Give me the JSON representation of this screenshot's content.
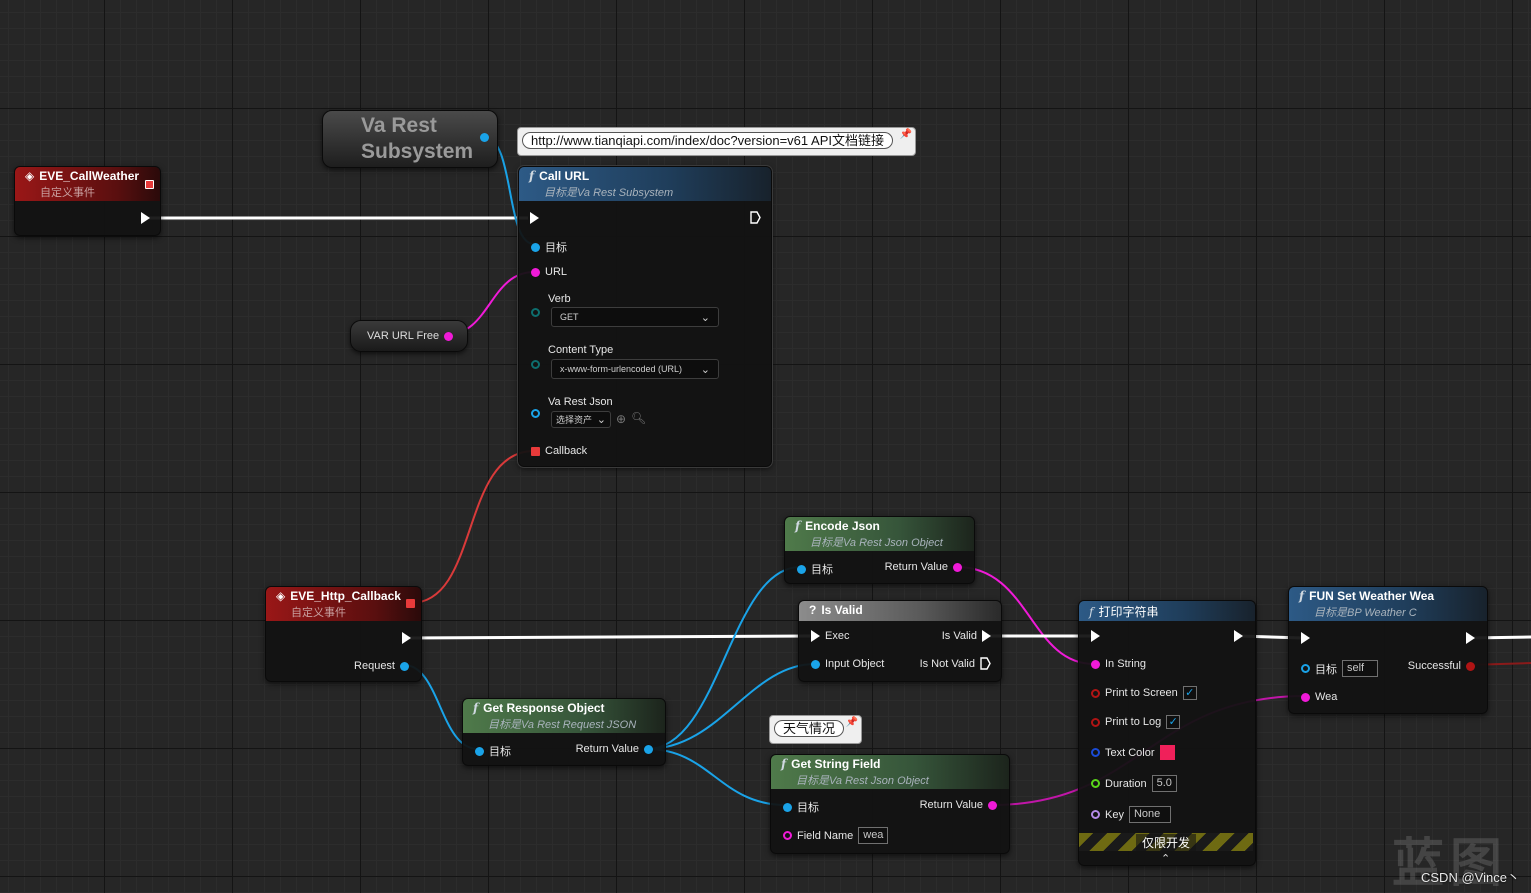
{
  "nodes": {
    "eve_callweather": {
      "title": "EVE_CallWeather",
      "subtitle": "自定义事件"
    },
    "va_rest": {
      "title": "Va Rest Subsystem"
    },
    "url_comment": {
      "text": "http://www.tianqiapi.com/index/doc?version=v61 API文档链接"
    },
    "call_url": {
      "title": "Call URL",
      "subtitle": "目标是Va Rest Subsystem",
      "pin_target": "目标",
      "pin_url": "URL",
      "pin_verb": "Verb",
      "verb_value": "GET",
      "pin_content_type": "Content Type",
      "content_type_value": "x-www-form-urlencoded (URL)",
      "pin_json": "Va Rest Json",
      "json_value": "选择资产",
      "pin_callback": "Callback"
    },
    "var_url": {
      "label": "VAR URL Free"
    },
    "eve_http": {
      "title": "EVE_Http_Callback",
      "subtitle": "自定义事件",
      "pin_request": "Request"
    },
    "get_response": {
      "title": "Get Response Object",
      "subtitle": "目标是Va Rest Request JSON",
      "pin_target": "目标",
      "pin_return": "Return Value"
    },
    "encode_json": {
      "title": "Encode Json",
      "subtitle": "目标是Va Rest Json Object",
      "pin_target": "目标",
      "pin_return": "Return Value"
    },
    "is_valid": {
      "title": "Is Valid",
      "pin_exec": "Exec",
      "pin_is_valid": "Is Valid",
      "pin_input": "Input Object",
      "pin_not_valid": "Is Not Valid"
    },
    "weather_comment": {
      "text": "天气情况"
    },
    "get_string": {
      "title": "Get String Field",
      "subtitle": "目标是Va Rest Json Object",
      "pin_target": "目标",
      "pin_return": "Return Value",
      "pin_field": "Field Name",
      "field_value": "wea"
    },
    "print_string": {
      "title": "打印字符串",
      "pin_in_string": "In String",
      "pin_screen": "Print to Screen",
      "pin_log": "Print to Log",
      "pin_color": "Text Color",
      "pin_duration": "Duration",
      "duration_value": "5.0",
      "pin_key": "Key",
      "key_value": "None",
      "dev_only": "仅限开发",
      "text_color_hex": "#f0205a"
    },
    "fun_set": {
      "title": "FUN Set Weather Wea",
      "subtitle": "目标是BP Weather C",
      "pin_target": "目标",
      "target_value": "self",
      "pin_successful": "Successful",
      "pin_wea": "Wea"
    }
  },
  "watermark": {
    "big": "蓝图",
    "credit": "CSDN @Vince丶"
  },
  "colors": {
    "exec": "#ffffff",
    "object": "#1aa3e8",
    "string": "#f01ad8",
    "delegate": "#e83a3a",
    "bool": "#b01414"
  }
}
